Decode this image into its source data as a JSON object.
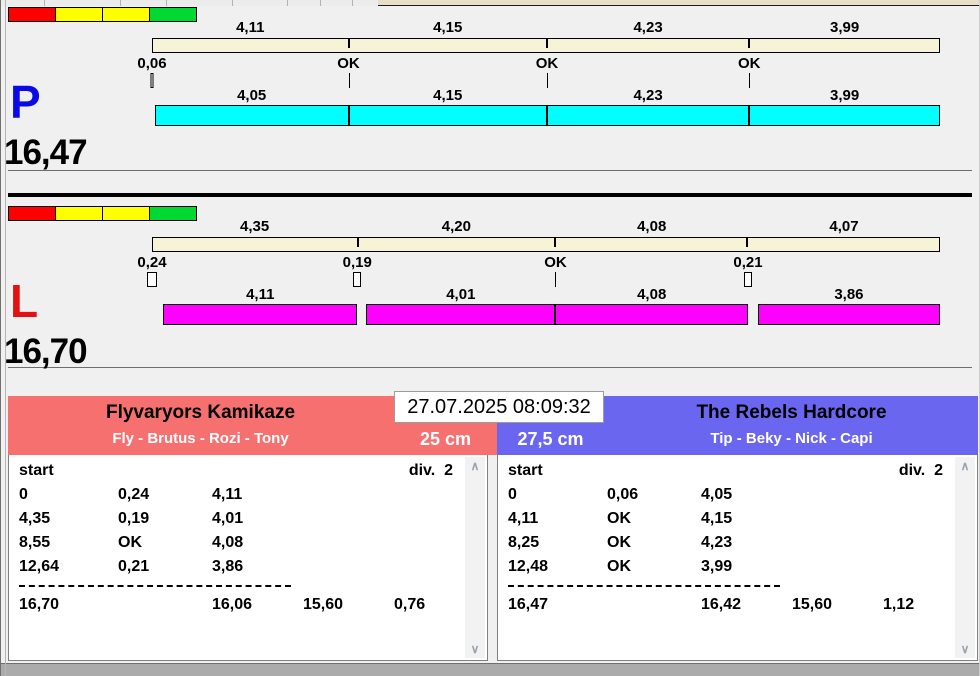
{
  "icons": {
    "scroll_up": "∧",
    "scroll_down": "∨"
  },
  "lanes": [
    {
      "letter": "P",
      "letter_color": "#0a0ae6",
      "total": "16,47",
      "traffic_lights": [
        "#ff0000",
        "#ffff00",
        "#ffff00",
        "#00d932"
      ],
      "splits": [
        {
          "label": "4,11",
          "value": 4.11
        },
        {
          "label": "4,15",
          "value": 4.15
        },
        {
          "label": "4,23",
          "value": 4.23
        },
        {
          "label": "3,99",
          "value": 3.99
        }
      ],
      "starts": [
        {
          "label": "0,06",
          "value": 0.06,
          "ok": false
        },
        {
          "label": "OK",
          "ok": true
        },
        {
          "label": "OK",
          "ok": true
        },
        {
          "label": "OK",
          "ok": true
        }
      ],
      "laps": [
        {
          "label": "4,05",
          "value": 4.05
        },
        {
          "label": "4,15",
          "value": 4.15
        },
        {
          "label": "4,23",
          "value": 4.23
        },
        {
          "label": "3,99",
          "value": 3.99
        }
      ],
      "lap_bar_color": "#00ffff"
    },
    {
      "letter": "L",
      "letter_color": "#e21212",
      "total": "16,70",
      "traffic_lights": [
        "#ff0000",
        "#ffff00",
        "#ffff00",
        "#00d932"
      ],
      "splits": [
        {
          "label": "4,35",
          "value": 4.35
        },
        {
          "label": "4,20",
          "value": 4.2
        },
        {
          "label": "4,08",
          "value": 4.08
        },
        {
          "label": "4,07",
          "value": 4.07
        }
      ],
      "starts": [
        {
          "label": "0,24",
          "value": 0.24,
          "ok": false
        },
        {
          "label": "0,19",
          "value": 0.19,
          "ok": false
        },
        {
          "label": "OK",
          "ok": true
        },
        {
          "label": "0,21",
          "value": 0.21,
          "ok": false
        }
      ],
      "laps": [
        {
          "label": "4,11",
          "value": 4.11
        },
        {
          "label": "4,01",
          "value": 4.01
        },
        {
          "label": "4,08",
          "value": 4.08
        },
        {
          "label": "3,86",
          "value": 3.86
        }
      ],
      "lap_bar_color": "#ff00ff"
    }
  ],
  "results": {
    "datetime": "27.07.2025 08:09:32",
    "teams": [
      {
        "name": "Flyvaryors Kamikaze",
        "dogs": "Fly - Brutus - Rozi - Tony",
        "height": "25 cm",
        "color": "#f77070",
        "table": {
          "header_left": "start",
          "header_right": "div.  2",
          "rows": [
            [
              "0",
              "0,24",
              "4,11"
            ],
            [
              "4,35",
              "0,19",
              "4,01"
            ],
            [
              "8,55",
              "OK",
              "4,08"
            ],
            [
              "12,64",
              "0,21",
              "3,86"
            ]
          ],
          "totals": [
            "16,70",
            "16,06",
            "15,60",
            "0,76"
          ]
        }
      },
      {
        "name": "The Rebels Hardcore",
        "dogs": "Tip - Beky - Nick - Capi",
        "height": "27,5 cm",
        "color": "#6a66ef",
        "table": {
          "header_left": "start",
          "header_right": "div.  2",
          "rows": [
            [
              "0",
              "0,06",
              "4,05"
            ],
            [
              "4,11",
              "OK",
              "4,15"
            ],
            [
              "8,25",
              "OK",
              "4,23"
            ],
            [
              "12,48",
              "OK",
              "3,99"
            ]
          ],
          "totals": [
            "16,47",
            "16,42",
            "15,60",
            "1,12"
          ]
        }
      }
    ]
  }
}
